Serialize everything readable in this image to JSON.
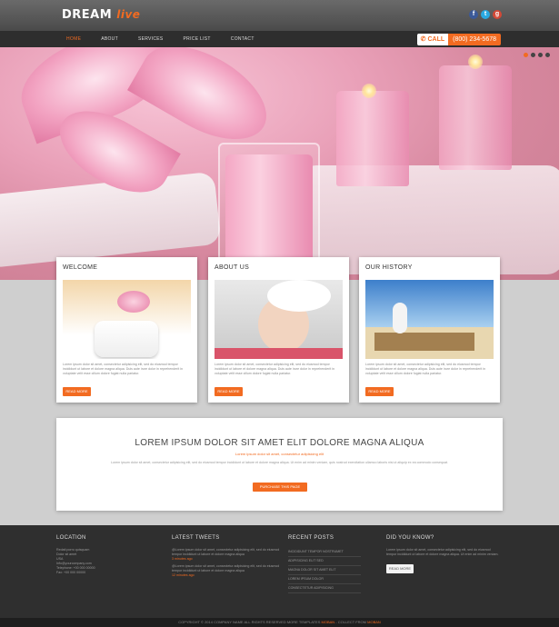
{
  "logo": {
    "main": "DREAM",
    "accent": "live"
  },
  "social": [
    {
      "icon": "facebook-icon",
      "glyph": "f",
      "color": "#3b5998"
    },
    {
      "icon": "twitter-icon",
      "glyph": "t",
      "color": "#29a9e1"
    },
    {
      "icon": "google-plus-icon",
      "glyph": "g",
      "color": "#d34836"
    }
  ],
  "nav": [
    "HOME",
    "ABOUT",
    "SERVICES",
    "PRICE LIST",
    "CONTACT"
  ],
  "call": {
    "label": "CALL",
    "number": "(800) 234-5678"
  },
  "boxes": [
    {
      "title": "WELCOME",
      "text": "Lorem ipsum dolor sit amet, consectetur adipisicing elit, sed do eiusmod tempor incididunt ut labore et dolore magna aliqua. Duis aute irure dolor in reprehenderit in voluptate velit esse cillum dolore fugiat nulla pariatur.",
      "button": "READ MORE"
    },
    {
      "title": "ABOUT US",
      "text": "Lorem ipsum dolor sit amet, consectetur adipisicing elit, sed do eiusmod tempor incididunt ut labore et dolore magna aliqua. Duis aute irure dolor in reprehenderit in voluptate velit esse cillum dolore fugiat nulla pariatur.",
      "button": "READ MORE"
    },
    {
      "title": "OUR HISTORY",
      "text": "Lorem ipsum dolor sit amet, consectetur adipisicing elit, sed do eiusmod tempor incididunt ut labore et dolore magna aliqua. Duis aute irure dolor in reprehenderit in voluptate velit esse cillum dolore fugiat nulla pariatur.",
      "button": "READ MORE"
    }
  ],
  "cta": {
    "title": "LOREM IPSUM DOLOR SIT AMET ELIT DOLORE MAGNA ALIQUA",
    "subtitle": "Lorem ipsum dolor sit amet, consectetur adipisicing elit",
    "text": "Lorem ipsum dolor sit amet, consectetur adipisicing elit, sed do eiusmod tempor incididunt ut labore et dolore magna aliqua. Ut enim ad minim veniam, quis nostrud exercitation ullamco laboris nisi ut aliquip ex ea commodo consequat.",
    "button": "PURCHASE THIS PAGE"
  },
  "footer": {
    "location": {
      "title": "LOCATION",
      "lines": [
        "Redati porro quisquam",
        "Dolor sit amet",
        "USA",
        "Info@yourcompany.com",
        "Telephone: +00 000 00000",
        "Fax: +00 000 00000"
      ]
    },
    "tweets": {
      "title": "LATEST TWEETS",
      "items": [
        {
          "text": "@Lorem ipsum dolor sit amet, consectetur adipisicing elit, sed do eiusmod tempor incididunt ut labore et dolore magna aliqua",
          "time": "3 minutes ago"
        },
        {
          "text": "@Lorem ipsum dolor sit amet, consectetur adipisicing elit, sed do eiusmod tempor incididunt ut labore et dolore magna aliqua",
          "time": "12 minutes ago"
        }
      ]
    },
    "posts": {
      "title": "RECENT POSTS",
      "items": [
        "INCIDIDUNT TEMPOR NOSTRUMET",
        "ADIPISICING ELIT SED",
        "MAGNA DOLOR SIT AMET ELIT",
        "LOREM IPSUM DOLOR",
        "CONSECTETUR ADIPISICING"
      ]
    },
    "know": {
      "title": "DID YOU KNOW?",
      "text": "Lorem ipsum dolor sit amet, consectetur adipisicing elit, sed do eiusmod tempor incididunt ut labore et dolore magna aliqua. Ut enim ad minim veniam.",
      "button": "READ MORE"
    }
  },
  "copyright": {
    "main": "COPYRIGHT © 2014 COMPANY NAME ALL RIGHTS RESERVED MORE TEMPLATES",
    "link1": "MOBAN",
    "mid": "- COLLECT FROM",
    "link2": "MOBAN"
  },
  "colors": {
    "accent": "#f26b21",
    "header": "#4a4a4a",
    "nav": "#2e2e2e",
    "footer": "#2f2f2f"
  }
}
